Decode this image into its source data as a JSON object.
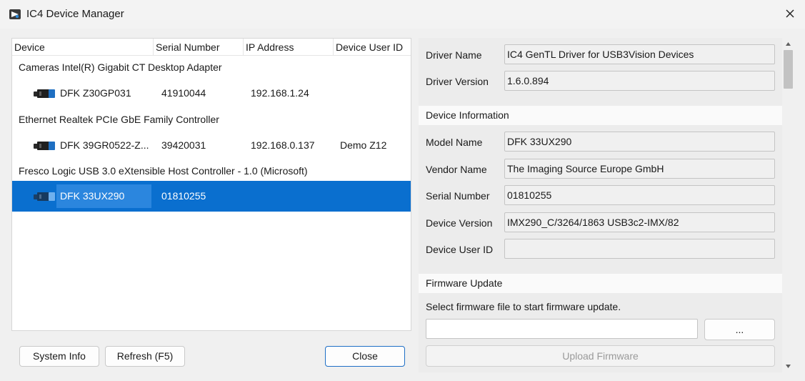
{
  "window": {
    "title": "IC4 Device Manager"
  },
  "device_list": {
    "columns": [
      "Device",
      "Serial Number",
      "IP Address",
      "Device User ID"
    ],
    "groups": [
      {
        "label": "Cameras Intel(R) Gigabit CT Desktop Adapter",
        "devices": [
          {
            "name": "DFK Z30GP031",
            "serial": "41910044",
            "ip": "192.168.1.24",
            "user_id": ""
          }
        ]
      },
      {
        "label": "Ethernet Realtek PCIe GbE Family Controller",
        "devices": [
          {
            "name": "DFK 39GR0522-Z...",
            "serial": "39420031",
            "ip": "192.168.0.137",
            "user_id": "Demo Z12"
          }
        ]
      },
      {
        "label": "Fresco Logic USB 3.0 eXtensible Host Controller - 1.0 (Microsoft)",
        "devices": [
          {
            "name": "DFK 33UX290",
            "serial": "01810255",
            "ip": "",
            "user_id": "",
            "selected": true
          }
        ]
      }
    ]
  },
  "buttons": {
    "system_info": "System Info",
    "refresh": "Refresh (F5)",
    "close": "Close"
  },
  "driver": {
    "name_label": "Driver Name",
    "name_value": "IC4 GenTL Driver for USB3Vision Devices",
    "version_label": "Driver Version",
    "version_value": "1.6.0.894"
  },
  "device_info": {
    "section_title": "Device Information",
    "model_label": "Model Name",
    "model_value": "DFK 33UX290",
    "vendor_label": "Vendor Name",
    "vendor_value": "The Imaging Source Europe GmbH",
    "serial_label": "Serial Number",
    "serial_value": "01810255",
    "version_label": "Device Version",
    "version_value": "IMX290_C/3264/1863 USB3c2-IMX/82",
    "user_id_label": "Device User ID",
    "user_id_value": ""
  },
  "firmware": {
    "section_title": "Firmware Update",
    "instruction": "Select firmware file to start firmware update.",
    "file_path": "",
    "browse_label": "...",
    "upload_label": "Upload Firmware"
  },
  "colors": {
    "selection": "#0a6fcf",
    "accent_border": "#1f6fc6"
  }
}
